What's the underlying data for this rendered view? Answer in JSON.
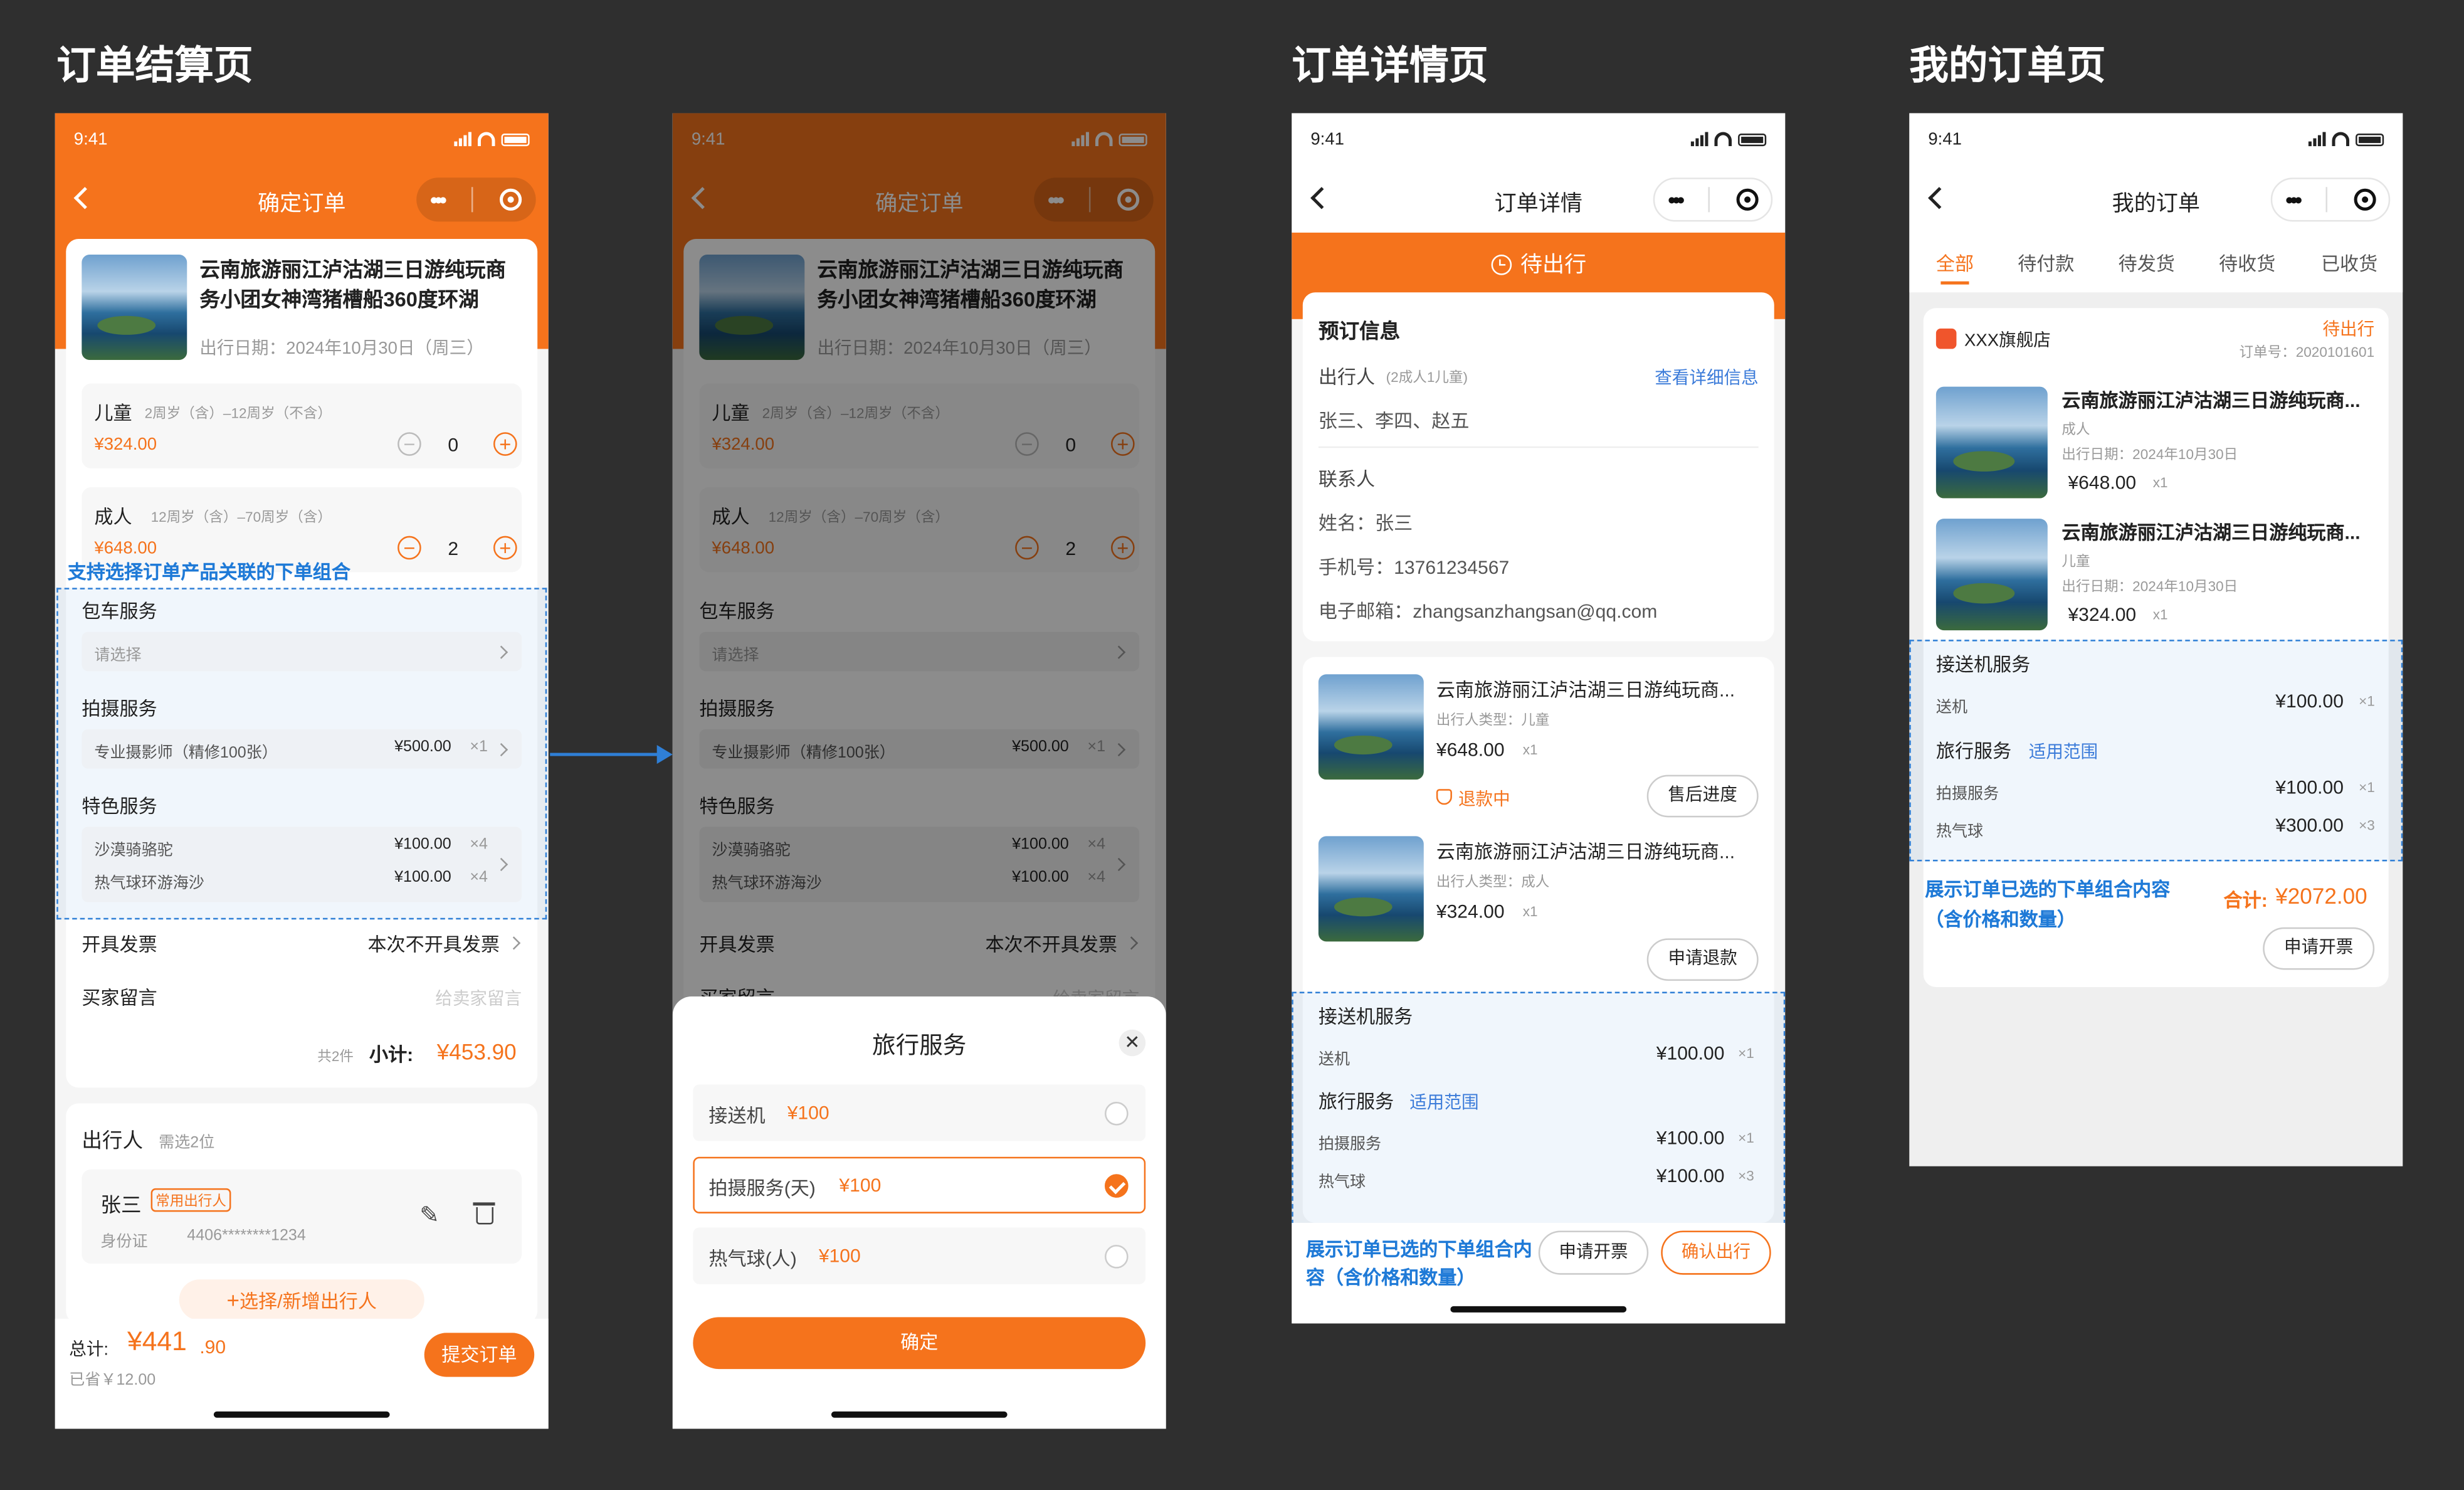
{
  "sections": {
    "checkout": "订单结算页",
    "detail": "订单详情页",
    "myorders": "我的订单页"
  },
  "status_time": "9:41",
  "product_name_full": "云南旅游丽江泸沽湖三日游纯玩商务小团女神湾猪槽船360度环湖",
  "product_name_short": "云南旅游丽江泸沽湖三日游纯玩商...",
  "checkout": {
    "nav_title": "确定订单",
    "travel_date": "出行日期：2024年10月30日（周三）",
    "child_label": "儿童",
    "child_age": "2周岁（含）–12周岁（不含）",
    "child_price": "¥324.00",
    "child_qty": "0",
    "adult_label": "成人",
    "adult_age": "12周岁（含）–70周岁（含）",
    "adult_price": "¥648.00",
    "adult_qty": "2",
    "annotation": "支持选择订单产品关联的下单组合",
    "charter_label": "包车服务",
    "charter_placeholder": "请选择",
    "photo_label": "拍摄服务",
    "photo_item": "专业摄影师（精修100张）",
    "photo_price": "¥500.00",
    "photo_qty": "×1",
    "special_label": "特色服务",
    "special_item1": "沙漠骑骆驼",
    "special_price1": "¥100.00",
    "special_qty1": "×4",
    "special_item2": "热气球环游海沙",
    "special_price2": "¥100.00",
    "special_qty2": "×4",
    "invoice_label": "开具发票",
    "invoice_value": "本次不开具发票",
    "message_label": "买家留言",
    "message_placeholder": "给卖家留言",
    "count_text": "共2件",
    "subtotal_label": "小计:",
    "subtotal_value": "¥453.90",
    "traveler_title": "出行人",
    "traveler_hint": "需选2位",
    "traveler_name": "张三",
    "traveler_tag": "常用出行人",
    "traveler_id_label": "身份证",
    "traveler_id": "4406********1234",
    "add_traveler": "选择/新增出行人",
    "total_label": "总计:",
    "total_int": "¥441",
    "total_dec": ".90",
    "saved": "已省￥12.00",
    "submit": "提交订单"
  },
  "sheet": {
    "title": "旅行服务",
    "options": [
      {
        "label": "接送机",
        "price": "¥100"
      },
      {
        "label": "拍摄服务(天)",
        "price": "¥100"
      },
      {
        "label": "热气球(人)",
        "price": "¥100"
      }
    ],
    "confirm": "确定"
  },
  "detail": {
    "nav_title": "订单详情",
    "status": "待出行",
    "booking_title": "预订信息",
    "traveler_label": "出行人",
    "traveler_count": "(2成人1儿童)",
    "view_detail": "查看详细信息",
    "traveler_names": "张三、李四、赵五",
    "contact_label": "联系人",
    "contact_name": "姓名：张三",
    "contact_phone": "手机号：13761234567",
    "contact_email": "电子邮箱：zhangsanzhangsan@qq.com",
    "item1_type": "出行人类型：儿童",
    "item1_price": "¥648.00",
    "item1_qty": "x1",
    "item1_refund": "退款中",
    "item1_btn": "售后进度",
    "item2_type": "出行人类型：成人",
    "item2_price": "¥324.00",
    "item2_qty": "x1",
    "item2_btn": "申请退款",
    "transfer_label": "接送机服务",
    "pickup": "送机",
    "pickup_price": "¥100.00",
    "pickup_qty": "×1",
    "travel_label": "旅行服务",
    "scope": "适用范围",
    "photo": "拍摄服务",
    "photo_price": "¥100.00",
    "photo_qty": "×1",
    "balloon": "热气球",
    "balloon_price": "¥100.00",
    "balloon_qty": "×3",
    "annotation": "展示订单已选的下单组合内容（含价格和数量）",
    "invoice_btn": "申请开票",
    "confirm_btn": "确认出行"
  },
  "orders": {
    "nav_title": "我的订单",
    "tabs": [
      "全部",
      "待付款",
      "待发货",
      "待收货",
      "已收货"
    ],
    "store": "XXX旗舰店",
    "order_status": "待出行",
    "order_no": "订单号：2020101601",
    "item1_type": "成人",
    "item1_date": "出行日期：2024年10月30日",
    "item1_price": "¥648.00",
    "item1_qty": "x1",
    "item2_type": "儿童",
    "item2_date": "出行日期：2024年10月30日",
    "item2_price": "¥324.00",
    "item2_qty": "x1",
    "transfer_label": "接送机服务",
    "pickup": "送机",
    "pickup_price": "¥100.00",
    "pickup_qty": "×1",
    "travel_label": "旅行服务",
    "scope": "适用范围",
    "photo": "拍摄服务",
    "photo_price": "¥100.00",
    "photo_qty": "×1",
    "balloon": "热气球",
    "balloon_price": "¥300.00",
    "balloon_qty": "×3",
    "annotation": "展示订单已选的下单组合内容（含价格和数量）",
    "total_label": "合计:",
    "total_value": "¥2072.00",
    "invoice_btn": "申请开票"
  },
  "colors": {
    "accent": "#f5731c",
    "annotation_blue": "#1f7ad7",
    "background": "#2f2f2f"
  }
}
